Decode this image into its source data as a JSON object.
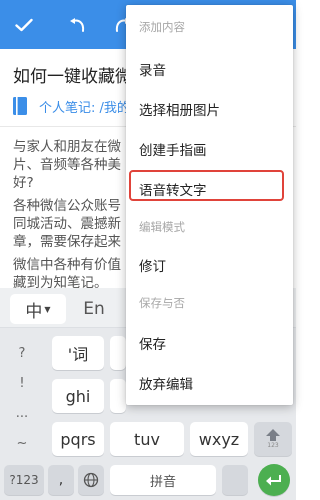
{
  "toolbar": {
    "background": "#3b8ee8",
    "buttons": [
      {
        "name": "check-icon"
      },
      {
        "name": "undo-icon"
      },
      {
        "name": "redo-icon"
      }
    ]
  },
  "note": {
    "title": "如何一键收藏微",
    "folder_path": "个人笔记: /我的",
    "paragraphs": [
      "与家人和朋友在微\n片、音频等各种美\n好?",
      "各种微信公众账号\n同城活动、震撼新\n章，需要保存起来",
      "微信中各种有价值\n藏到为知笔记。"
    ]
  },
  "keyboard": {
    "tabs": {
      "chinese": "中",
      "english": "En"
    },
    "punctuation": [
      "?",
      "!",
      "...",
      "~"
    ],
    "keys": {
      "k1": "'词",
      "k4": "ghi",
      "k7": "pqrs",
      "k8": "tuv",
      "k9": "wxyz",
      "shift_sub": "123",
      "symbols": "?123",
      "comma": ",",
      "space": "拼音"
    },
    "enter_color": "#4caf50"
  },
  "menu": {
    "items": [
      {
        "type": "header",
        "label": "添加内容"
      },
      {
        "type": "action",
        "label": "录音"
      },
      {
        "type": "action",
        "label": "选择相册图片"
      },
      {
        "type": "action",
        "label": "创建手指画"
      },
      {
        "type": "action",
        "label": "语音转文字",
        "highlighted": true
      },
      {
        "type": "header",
        "label": "编辑模式"
      },
      {
        "type": "action",
        "label": "修订"
      },
      {
        "type": "header",
        "label": "保存与否"
      },
      {
        "type": "action",
        "label": "保存"
      },
      {
        "type": "action",
        "label": "放弃编辑"
      }
    ],
    "highlight_color": "#e0433a"
  }
}
